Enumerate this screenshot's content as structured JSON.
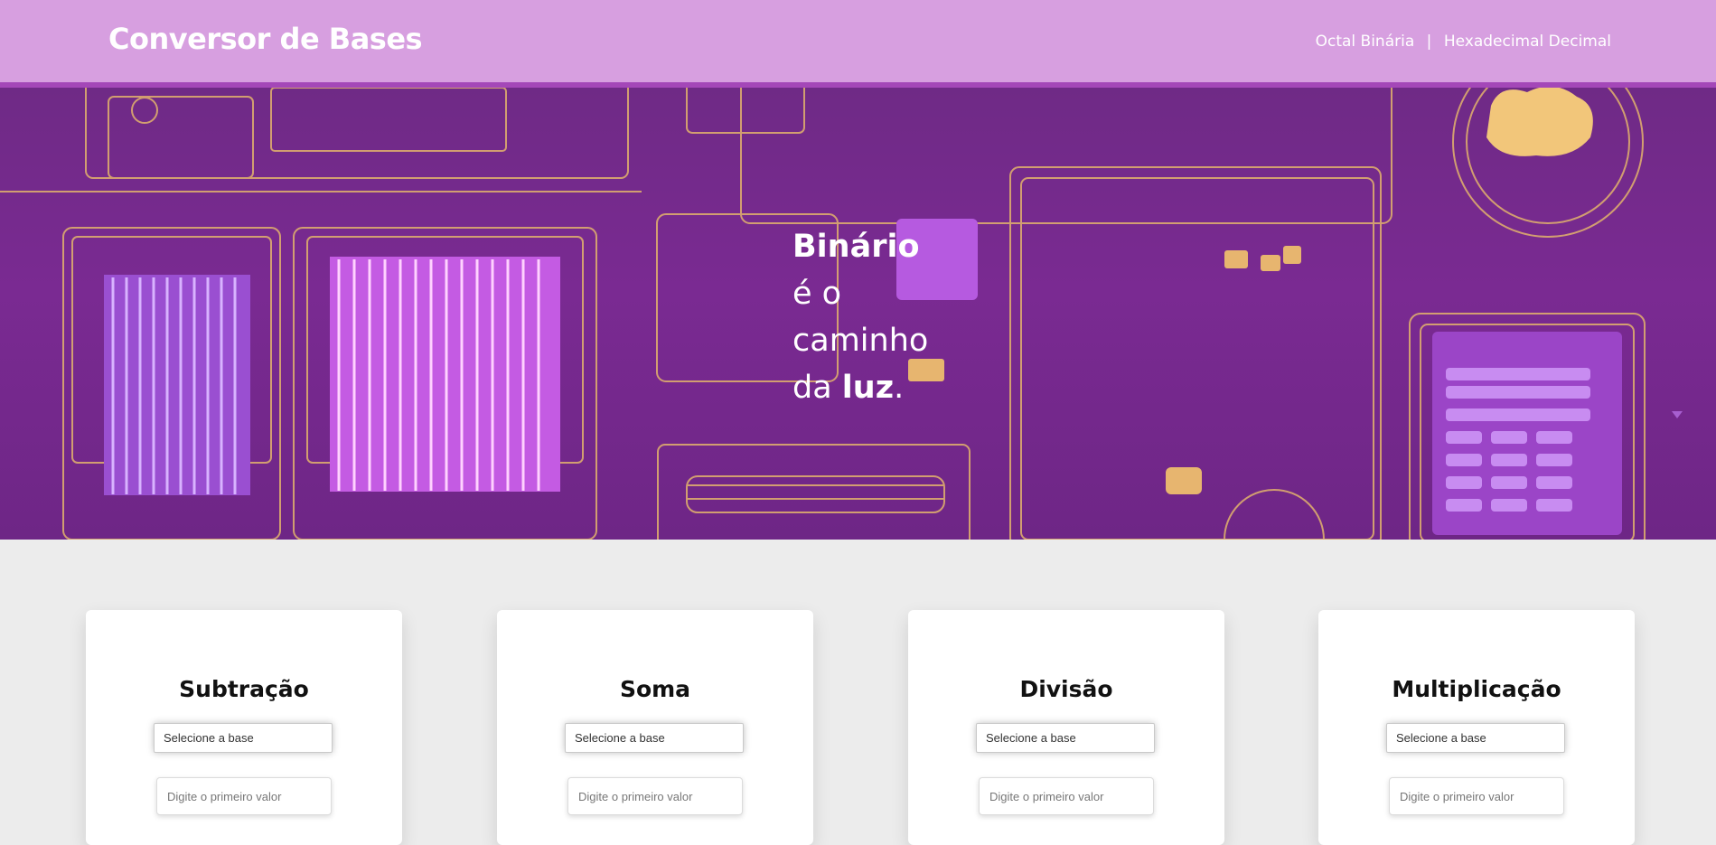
{
  "header": {
    "brand": "Conversor de Bases",
    "nav": [
      "Octal",
      "Binária",
      "|",
      "Hexadecimal",
      "Decimal"
    ]
  },
  "hero": {
    "word1": "Binário",
    "line2": "é o",
    "line3": "caminho",
    "line4_start": "da ",
    "line4_bold": "luz",
    "line4_end": "."
  },
  "cards": [
    {
      "title": "Subtração",
      "select_label": "Selecione a base",
      "input_placeholder": "Digite o primeiro valor"
    },
    {
      "title": "Soma",
      "select_label": "Selecione a base",
      "input_placeholder": "Digite o primeiro valor"
    },
    {
      "title": "Divisão",
      "select_label": "Selecione a base",
      "input_placeholder": "Digite o primeiro valor"
    },
    {
      "title": "Multiplicação",
      "select_label": "Selecione a base",
      "input_placeholder": "Digite o primeiro valor"
    }
  ],
  "colors": {
    "header_bg": "#d79fe0",
    "header_border": "#a447b8",
    "hero_purple": "#76298d",
    "circuit_gold": "#e3b36c",
    "page_bg": "#ececec"
  }
}
